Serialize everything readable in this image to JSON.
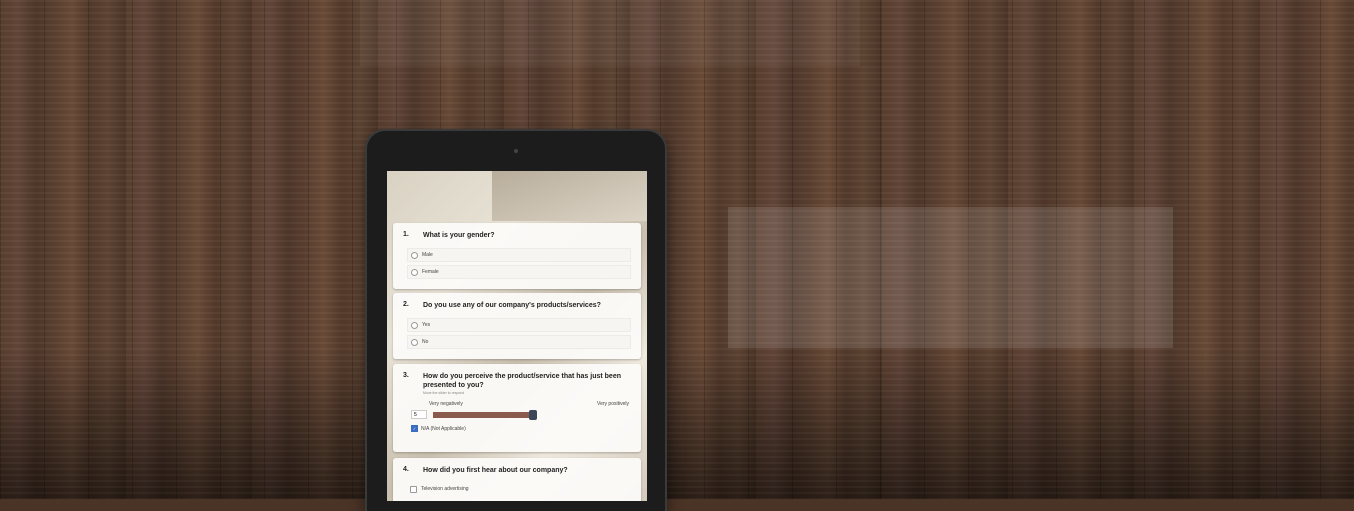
{
  "survey": {
    "questions": [
      {
        "number": "1.",
        "text": "What is your gender?",
        "options": [
          "Male",
          "Female"
        ]
      },
      {
        "number": "2.",
        "text": "Do you use any of our company's products/services?",
        "options": [
          "Yes",
          "No"
        ]
      },
      {
        "number": "3.",
        "text": "How do you perceive the product/service that has just been presented to you?",
        "help": "Move the slider to respond",
        "scale_low": "Very negatively",
        "scale_high": "Very positively",
        "value": "5",
        "na_label": "N/A (Not Applicable)",
        "na_checked": true
      },
      {
        "number": "4.",
        "text": "How did you first hear about our company?",
        "options": [
          "Television advertising"
        ]
      }
    ]
  }
}
